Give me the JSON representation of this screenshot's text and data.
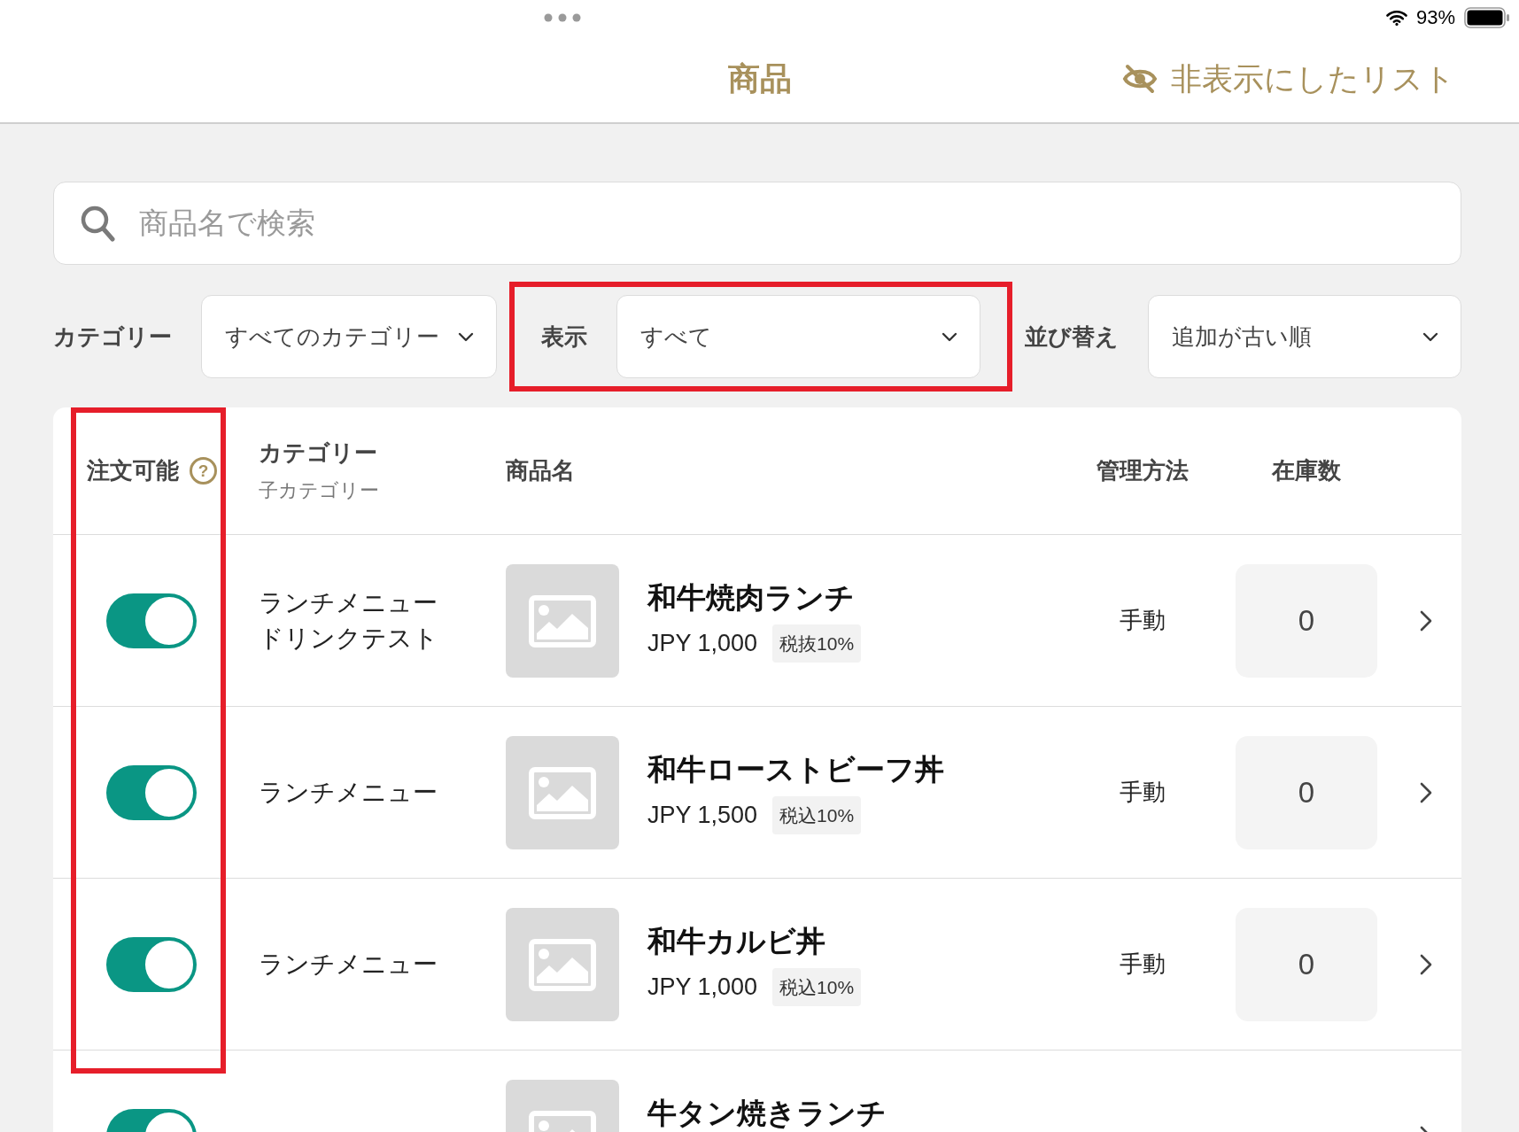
{
  "status_bar": {
    "battery": "93%"
  },
  "nav_bar": {
    "title": "商品",
    "hidden_list_link": "非表示にしたリスト"
  },
  "search": {
    "placeholder": "商品名で検索"
  },
  "filters": [
    {
      "label": "カテゴリー",
      "value": "すべてのカテゴリー",
      "highlighted": false
    },
    {
      "label": "表示",
      "value": "すべて",
      "highlighted": true
    },
    {
      "label": "並び替え",
      "value": "追加が古い順",
      "highlighted": false
    }
  ],
  "table": {
    "columns": [
      {
        "label": "注文可能",
        "help": "?",
        "highlighted": true
      },
      {
        "label": "カテゴリー",
        "sublabel": "子カテゴリー",
        "highlighted": false
      },
      {
        "label": "商品名",
        "highlighted": false
      },
      {
        "label": "管理方法",
        "highlighted": false
      },
      {
        "label": "在庫数",
        "highlighted": false
      }
    ],
    "rows": [
      {
        "orderable": true,
        "category": "ランチメニュー",
        "subcategory": "ドリンクテスト",
        "name": "和牛焼肉ランチ",
        "price": "JPY 1,000",
        "tax": "税抜10%",
        "management": "手動",
        "stock": "0"
      },
      {
        "orderable": true,
        "category": "ランチメニュー",
        "name": "和牛ローストビーフ丼",
        "price": "JPY 1,500",
        "tax": "税込10%",
        "management": "手動",
        "stock": "0"
      },
      {
        "orderable": true,
        "category": "ランチメニュー",
        "name": "和牛カルビ丼",
        "price": "JPY 1,000",
        "tax": "税込10%",
        "management": "手動",
        "stock": "0"
      },
      {
        "orderable": true,
        "name": "牛タン焼きランチ"
      }
    ]
  }
}
